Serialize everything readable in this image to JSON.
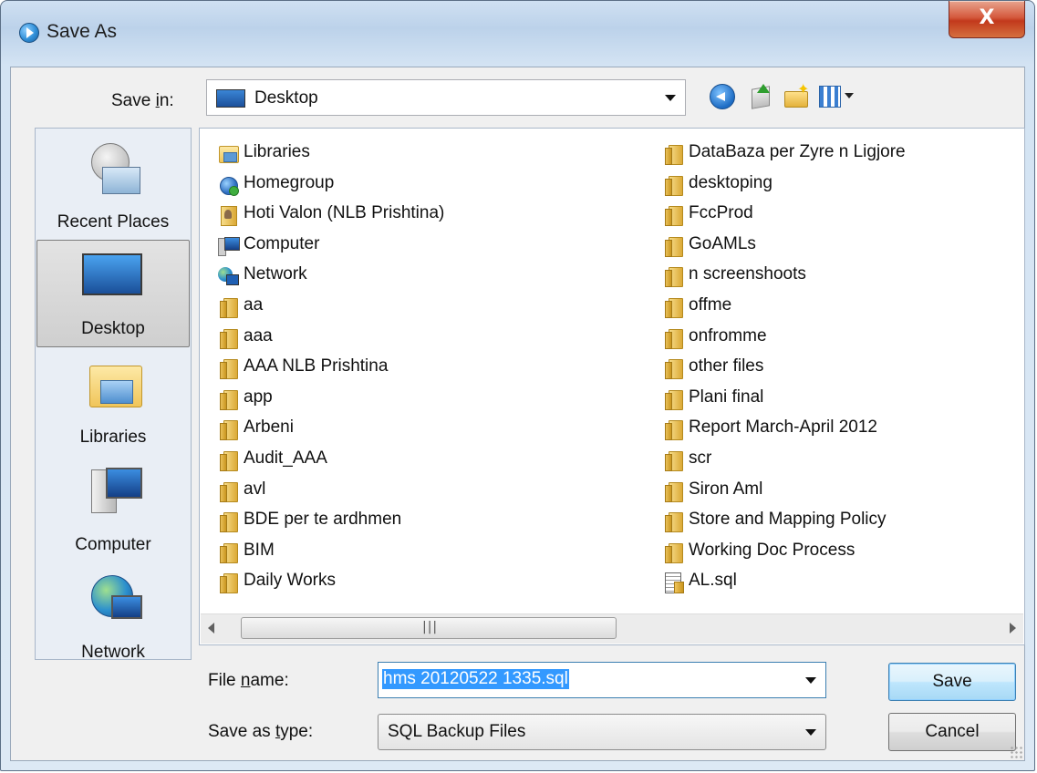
{
  "window": {
    "title": "Save As",
    "close_label": "X"
  },
  "toolbar": {
    "save_in_label": "Save in:",
    "save_in_value": "Desktop"
  },
  "places": [
    {
      "label": "Recent Places",
      "icon": "recent-places-icon"
    },
    {
      "label": "Desktop",
      "icon": "desktop-icon",
      "selected": true
    },
    {
      "label": "Libraries",
      "icon": "libraries-icon"
    },
    {
      "label": "Computer",
      "icon": "computer-icon"
    },
    {
      "label": "Network",
      "icon": "network-icon"
    }
  ],
  "files": {
    "left": [
      {
        "name": "Libraries",
        "icon": "libraries"
      },
      {
        "name": "Homegroup",
        "icon": "homegroup"
      },
      {
        "name": "Hoti Valon (NLB Prishtina)",
        "icon": "user"
      },
      {
        "name": "Computer",
        "icon": "computer"
      },
      {
        "name": "Network",
        "icon": "network"
      },
      {
        "name": "aa",
        "icon": "folder"
      },
      {
        "name": "aaa",
        "icon": "folder"
      },
      {
        "name": "AAA NLB Prishtina",
        "icon": "folder"
      },
      {
        "name": "app",
        "icon": "folder"
      },
      {
        "name": "Arbeni",
        "icon": "folder"
      },
      {
        "name": "Audit_AAA",
        "icon": "folder"
      },
      {
        "name": "avl",
        "icon": "folder"
      },
      {
        "name": "BDE per te ardhmen",
        "icon": "folder"
      },
      {
        "name": "BIM",
        "icon": "folder"
      },
      {
        "name": "Daily Works",
        "icon": "folder"
      }
    ],
    "right": [
      {
        "name": "DataBaza per Zyre n Ligjore",
        "icon": "folder"
      },
      {
        "name": "desktoping",
        "icon": "folder"
      },
      {
        "name": "FccProd",
        "icon": "folder"
      },
      {
        "name": "GoAMLs",
        "icon": "folder"
      },
      {
        "name": "n screenshoots",
        "icon": "folder"
      },
      {
        "name": "offme",
        "icon": "folder"
      },
      {
        "name": "onfromme",
        "icon": "folder"
      },
      {
        "name": "other files",
        "icon": "folder"
      },
      {
        "name": "Plani final",
        "icon": "folder"
      },
      {
        "name": "Report March-April 2012",
        "icon": "folder"
      },
      {
        "name": "scr",
        "icon": "folder"
      },
      {
        "name": "Siron Aml",
        "icon": "folder"
      },
      {
        "name": "Store and Mapping Policy",
        "icon": "folder"
      },
      {
        "name": "Working Doc Process",
        "icon": "folder"
      },
      {
        "name": "AL.sql",
        "icon": "sqlfile"
      }
    ]
  },
  "form": {
    "file_name_label_pre": "File ",
    "file_name_label_u": "n",
    "file_name_label_post": "ame:",
    "file_name_value": "hms 20120522 1335.sql",
    "save_as_type_label_pre": "Save as ",
    "save_as_type_label_u": "t",
    "save_as_type_label_post": "ype:",
    "save_as_type_value": "SQL Backup Files"
  },
  "buttons": {
    "save": "Save",
    "cancel": "Cancel"
  },
  "colors": {
    "selection": "#3399ff",
    "close_button": "#c2391c",
    "window_frame": "#bcd2ea"
  }
}
